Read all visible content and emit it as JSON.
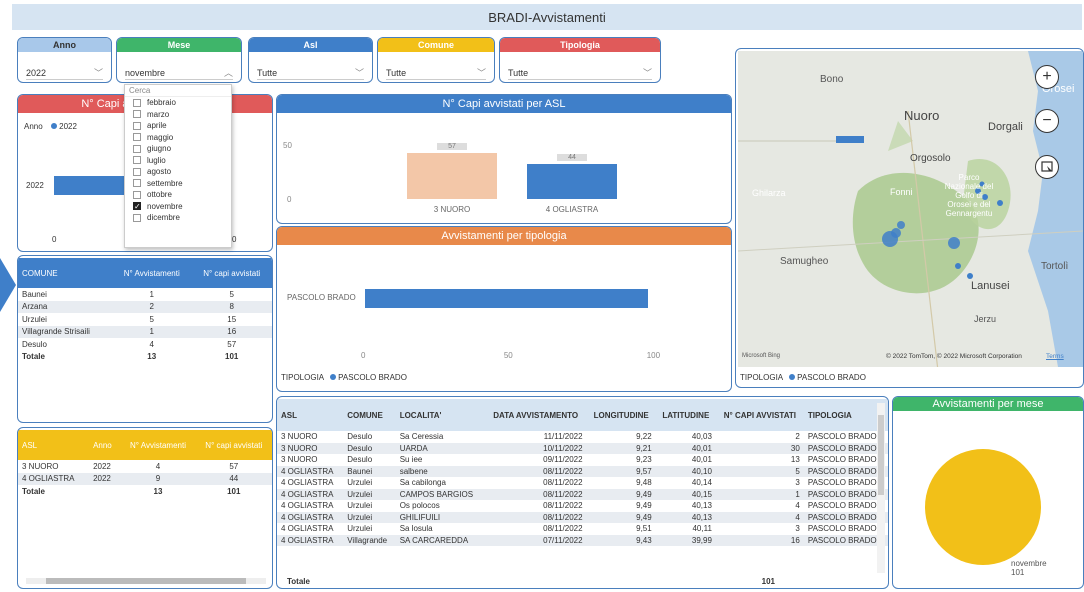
{
  "title": "BRADI-Avvistamenti",
  "slicers": {
    "anno": {
      "label": "Anno",
      "value": "2022",
      "color": "#a8c8ea"
    },
    "mese": {
      "label": "Mese",
      "value": "novembre",
      "color": "#3fb56a"
    },
    "asl": {
      "label": "Asl",
      "value": "Tutte",
      "color": "#3f7fc9"
    },
    "comune": {
      "label": "Comune",
      "value": "Tutte",
      "color": "#f2c018"
    },
    "tipologia": {
      "label": "Tipologia",
      "value": "Tutte",
      "color": "#e05a5a"
    }
  },
  "dropdown": {
    "search_placeholder": "Cerca",
    "items": [
      {
        "label": "febbraio",
        "checked": false
      },
      {
        "label": "marzo",
        "checked": false
      },
      {
        "label": "aprile",
        "checked": false
      },
      {
        "label": "maggio",
        "checked": false
      },
      {
        "label": "giugno",
        "checked": false
      },
      {
        "label": "luglio",
        "checked": false
      },
      {
        "label": "agosto",
        "checked": false
      },
      {
        "label": "settembre",
        "checked": false
      },
      {
        "label": "ottobre",
        "checked": false
      },
      {
        "label": "novembre",
        "checked": true
      },
      {
        "label": "dicembre",
        "checked": false
      }
    ]
  },
  "capi_anno": {
    "title": "N° Capi avvistati per anno",
    "legend_label": "Anno",
    "legend_item": "2022",
    "category": "2022",
    "x_min": "0",
    "x_max": "0"
  },
  "capi_asl": {
    "title": "N° Capi avvistati per ASL",
    "y_tick_50": "50",
    "y_tick_0": "0"
  },
  "tipologia_chart": {
    "title": "Avvistamenti per tipologia",
    "category": "PASCOLO BRADO",
    "x_ticks": [
      "0",
      "50",
      "100"
    ],
    "legend_label": "TIPOLOGIA",
    "legend_item": "PASCOLO BRADO"
  },
  "map": {
    "labels": {
      "bono": "Bono",
      "orosei": "Orosei",
      "nuoro": "Nuoro",
      "dorgali": "Dorgali",
      "orgosolo": "Orgosolo",
      "ghilarza": "Ghilarza",
      "fonni": "Fonni",
      "parco": "Parco Nazionale del Golfo di Orosei e del Gennargentu",
      "samugheo": "Samugheo",
      "tortoli": "Tortolì",
      "lanusei": "Lanusei",
      "jerzu": "Jerzu"
    },
    "zoom_in": "+",
    "zoom_out": "−",
    "bing": "Microsoft Bing",
    "copyright": "© 2022 TomTom, © 2022 Microsoft Corporation",
    "terms": "Terms",
    "legend_label": "TIPOLOGIA",
    "legend_item": "PASCOLO BRADO"
  },
  "comune_table": {
    "headers": [
      "COMUNE",
      "N° Avvistamenti",
      "N° capi avvistati"
    ],
    "rows": [
      [
        "Baunei",
        "1",
        "5"
      ],
      [
        "Arzana",
        "2",
        "8"
      ],
      [
        "Urzulei",
        "5",
        "15"
      ],
      [
        "Villagrande Strisaili",
        "1",
        "16"
      ],
      [
        "Desulo",
        "4",
        "57"
      ]
    ],
    "total": [
      "Totale",
      "13",
      "101"
    ]
  },
  "asl_table": {
    "headers": [
      "ASL",
      "Anno",
      "N° Avvistamenti",
      "N° capi avvistati"
    ],
    "rows": [
      [
        "3 NUORO",
        "2022",
        "4",
        "57"
      ],
      [
        "4 OGLIASTRA",
        "2022",
        "9",
        "44"
      ]
    ],
    "total": [
      "Totale",
      "",
      "13",
      "101"
    ]
  },
  "detail_table": {
    "headers": [
      "ASL",
      "COMUNE",
      "LOCALITA'",
      "DATA AVVISTAMENTO",
      "LONGITUDINE",
      "LATITUDINE",
      "N° CAPI AVVISTATI",
      "TIPOLOGIA"
    ],
    "rows": [
      [
        "3 NUORO",
        "Desulo",
        "Sa Ceressia",
        "11/11/2022",
        "9,22",
        "40,03",
        "2",
        "PASCOLO BRADO"
      ],
      [
        "3 NUORO",
        "Desulo",
        "UARDA",
        "10/11/2022",
        "9,21",
        "40,01",
        "30",
        "PASCOLO BRADO"
      ],
      [
        "3 NUORO",
        "Desulo",
        "Su iee",
        "09/11/2022",
        "9,23",
        "40,01",
        "13",
        "PASCOLO BRADO"
      ],
      [
        "4 OGLIASTRA",
        "Baunei",
        "salbene",
        "08/11/2022",
        "9,57",
        "40,10",
        "5",
        "PASCOLO BRADO"
      ],
      [
        "4 OGLIASTRA",
        "Urzulei",
        "Sa cabilonga",
        "08/11/2022",
        "9,48",
        "40,14",
        "3",
        "PASCOLO BRADO"
      ],
      [
        "4 OGLIASTRA",
        "Urzulei",
        "CAMPOS BARGIOS",
        "08/11/2022",
        "9,49",
        "40,15",
        "1",
        "PASCOLO BRADO"
      ],
      [
        "4 OGLIASTRA",
        "Urzulei",
        "Os polocos",
        "08/11/2022",
        "9,49",
        "40,13",
        "4",
        "PASCOLO BRADO"
      ],
      [
        "4 OGLIASTRA",
        "Urzulei",
        "GHILIFUILI",
        "08/11/2022",
        "9,49",
        "40,13",
        "4",
        "PASCOLO BRADO"
      ],
      [
        "4 OGLIASTRA",
        "Urzulei",
        "Sa losula",
        "08/11/2022",
        "9,51",
        "40,11",
        "3",
        "PASCOLO BRADO"
      ],
      [
        "4 OGLIASTRA",
        "Villagrande",
        "SA CARCAREDDA",
        "07/11/2022",
        "9,43",
        "39,99",
        "16",
        "PASCOLO BRADO"
      ]
    ],
    "total": [
      "Totale",
      "101"
    ]
  },
  "mese_chart": {
    "title": "Avvistamenti per mese",
    "label": "novembre",
    "value": "101"
  },
  "chart_data": [
    {
      "type": "bar",
      "title": "N° Capi avvistati per anno",
      "categories": [
        "2022"
      ],
      "values": [
        101
      ]
    },
    {
      "type": "bar",
      "title": "N° Capi avvistati per ASL",
      "categories": [
        "3 NUORO",
        "4 OGLIASTRA"
      ],
      "values": [
        57,
        44
      ],
      "ylim": [
        0,
        60
      ]
    },
    {
      "type": "bar",
      "title": "Avvistamenti per tipologia",
      "categories": [
        "PASCOLO BRADO"
      ],
      "values": [
        101
      ],
      "xlim": [
        0,
        100
      ]
    },
    {
      "type": "pie",
      "title": "Avvistamenti per mese",
      "categories": [
        "novembre"
      ],
      "values": [
        101
      ]
    }
  ],
  "colors": {
    "accent": "#3f7fc9",
    "peach": "#f3c7a8",
    "orange": "#e8894a",
    "red": "#e05a5a",
    "green": "#3fb56a",
    "yellow": "#f2c018"
  }
}
